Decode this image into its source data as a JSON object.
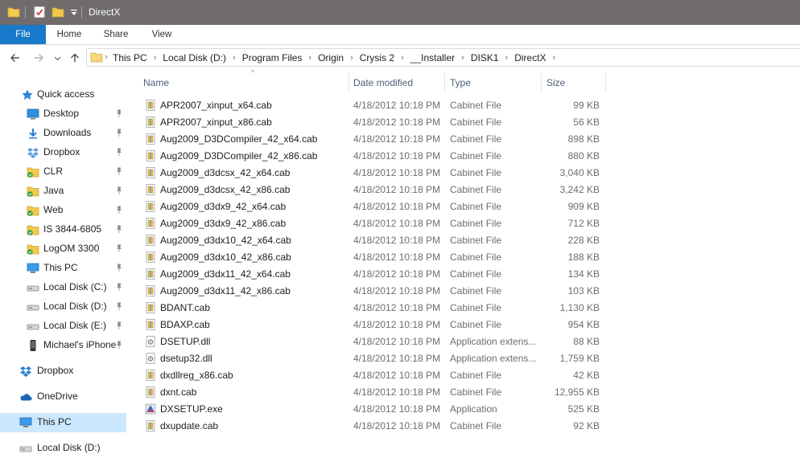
{
  "window": {
    "title": "DirectX"
  },
  "ribbon": {
    "tabs": [
      "File",
      "Home",
      "Share",
      "View"
    ]
  },
  "address": {
    "crumbs": [
      "This PC",
      "Local Disk (D:)",
      "Program Files",
      "Origin",
      "Crysis 2",
      "__Installer",
      "DISK1",
      "DirectX"
    ]
  },
  "nav": {
    "quick_access": "Quick access",
    "items": [
      {
        "label": "Desktop",
        "icon": "desktop-icon"
      },
      {
        "label": "Downloads",
        "icon": "downloads-icon"
      },
      {
        "label": "Dropbox",
        "icon": "dropbox-icon"
      },
      {
        "label": "CLR",
        "icon": "folder-synced-icon"
      },
      {
        "label": "Java",
        "icon": "folder-synced-icon"
      },
      {
        "label": "Web",
        "icon": "folder-synced-icon"
      },
      {
        "label": "IS 3844-6805",
        "icon": "folder-synced-icon"
      },
      {
        "label": "LogOM 3300",
        "icon": "folder-synced-icon"
      },
      {
        "label": "This PC",
        "icon": "pc-icon"
      },
      {
        "label": "Local Disk (C:)",
        "icon": "drive-icon"
      },
      {
        "label": "Local Disk (D:)",
        "icon": "drive-icon"
      },
      {
        "label": "Local Disk (E:)",
        "icon": "drive-icon"
      },
      {
        "label": "Michael's iPhone",
        "icon": "phone-icon"
      }
    ],
    "dropbox": "Dropbox",
    "onedrive": "OneDrive",
    "thispc": "This PC",
    "localdisk_d": "Local Disk (D:)"
  },
  "columns": {
    "name": "Name",
    "date": "Date modified",
    "type": "Type",
    "size": "Size"
  },
  "files": [
    {
      "name": "APR2007_xinput_x64.cab",
      "date": "4/18/2012 10:18 PM",
      "type": "Cabinet File",
      "size": "99 KB",
      "icon": "cab"
    },
    {
      "name": "APR2007_xinput_x86.cab",
      "date": "4/18/2012 10:18 PM",
      "type": "Cabinet File",
      "size": "56 KB",
      "icon": "cab"
    },
    {
      "name": "Aug2009_D3DCompiler_42_x64.cab",
      "date": "4/18/2012 10:18 PM",
      "type": "Cabinet File",
      "size": "898 KB",
      "icon": "cab"
    },
    {
      "name": "Aug2009_D3DCompiler_42_x86.cab",
      "date": "4/18/2012 10:18 PM",
      "type": "Cabinet File",
      "size": "880 KB",
      "icon": "cab"
    },
    {
      "name": "Aug2009_d3dcsx_42_x64.cab",
      "date": "4/18/2012 10:18 PM",
      "type": "Cabinet File",
      "size": "3,040 KB",
      "icon": "cab"
    },
    {
      "name": "Aug2009_d3dcsx_42_x86.cab",
      "date": "4/18/2012 10:18 PM",
      "type": "Cabinet File",
      "size": "3,242 KB",
      "icon": "cab"
    },
    {
      "name": "Aug2009_d3dx9_42_x64.cab",
      "date": "4/18/2012 10:18 PM",
      "type": "Cabinet File",
      "size": "909 KB",
      "icon": "cab"
    },
    {
      "name": "Aug2009_d3dx9_42_x86.cab",
      "date": "4/18/2012 10:18 PM",
      "type": "Cabinet File",
      "size": "712 KB",
      "icon": "cab"
    },
    {
      "name": "Aug2009_d3dx10_42_x64.cab",
      "date": "4/18/2012 10:18 PM",
      "type": "Cabinet File",
      "size": "228 KB",
      "icon": "cab"
    },
    {
      "name": "Aug2009_d3dx10_42_x86.cab",
      "date": "4/18/2012 10:18 PM",
      "type": "Cabinet File",
      "size": "188 KB",
      "icon": "cab"
    },
    {
      "name": "Aug2009_d3dx11_42_x64.cab",
      "date": "4/18/2012 10:18 PM",
      "type": "Cabinet File",
      "size": "134 KB",
      "icon": "cab"
    },
    {
      "name": "Aug2009_d3dx11_42_x86.cab",
      "date": "4/18/2012 10:18 PM",
      "type": "Cabinet File",
      "size": "103 KB",
      "icon": "cab"
    },
    {
      "name": "BDANT.cab",
      "date": "4/18/2012 10:18 PM",
      "type": "Cabinet File",
      "size": "1,130 KB",
      "icon": "cab"
    },
    {
      "name": "BDAXP.cab",
      "date": "4/18/2012 10:18 PM",
      "type": "Cabinet File",
      "size": "954 KB",
      "icon": "cab"
    },
    {
      "name": "DSETUP.dll",
      "date": "4/18/2012 10:18 PM",
      "type": "Application extens...",
      "size": "88 KB",
      "icon": "dll"
    },
    {
      "name": "dsetup32.dll",
      "date": "4/18/2012 10:18 PM",
      "type": "Application extens...",
      "size": "1,759 KB",
      "icon": "dll"
    },
    {
      "name": "dxdllreg_x86.cab",
      "date": "4/18/2012 10:18 PM",
      "type": "Cabinet File",
      "size": "42 KB",
      "icon": "cab"
    },
    {
      "name": "dxnt.cab",
      "date": "4/18/2012 10:18 PM",
      "type": "Cabinet File",
      "size": "12,955 KB",
      "icon": "cab"
    },
    {
      "name": "DXSETUP.exe",
      "date": "4/18/2012 10:18 PM",
      "type": "Application",
      "size": "525 KB",
      "icon": "exe"
    },
    {
      "name": "dxupdate.cab",
      "date": "4/18/2012 10:18 PM",
      "type": "Cabinet File",
      "size": "92 KB",
      "icon": "cab"
    }
  ],
  "colors": {
    "titlebar": "#6f6c6b",
    "file_tab": "#1979ca",
    "selected": "#cce8ff",
    "header_text": "#4c607a"
  }
}
